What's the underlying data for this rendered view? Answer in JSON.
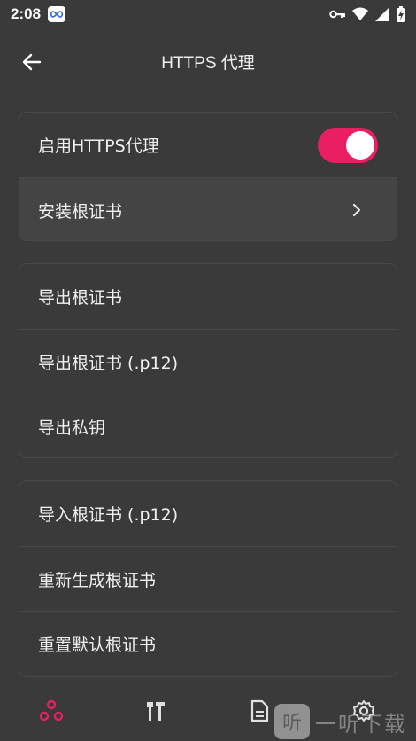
{
  "status_bar": {
    "time": "2:08",
    "icons": [
      "infinity-app-icon",
      "vpn-key-icon",
      "wifi-icon",
      "signal-icon",
      "battery-charging-icon"
    ]
  },
  "app_bar": {
    "title": "HTTPS 代理",
    "back_icon": "arrow-left-icon"
  },
  "card1": {
    "enable_https_proxy": {
      "label": "启用HTTPS代理",
      "enabled": true
    },
    "install_root_cert": {
      "label": "安装根证书",
      "icon": "chevron-right-icon"
    }
  },
  "card2": {
    "items": [
      {
        "label": "导出根证书"
      },
      {
        "label": "导出根证书 (.p12)"
      },
      {
        "label": "导出私钥"
      }
    ]
  },
  "card3": {
    "items": [
      {
        "label": "导入根证书 (.p12)"
      },
      {
        "label": "重新生成根证书"
      },
      {
        "label": "重置默认根证书"
      }
    ]
  },
  "bottom_nav": {
    "items": [
      {
        "icon": "network-nodes-icon",
        "active": true
      },
      {
        "icon": "tools-icon",
        "active": false
      },
      {
        "icon": "document-icon",
        "active": false
      },
      {
        "icon": "gear-icon",
        "active": false
      }
    ]
  },
  "watermark": {
    "glyph": "听",
    "text": "一听下载"
  },
  "colors": {
    "background": "#3a3a3a",
    "accent": "#e91e63",
    "card_border": "#4a4a4a",
    "text": "#f0f0f0"
  }
}
